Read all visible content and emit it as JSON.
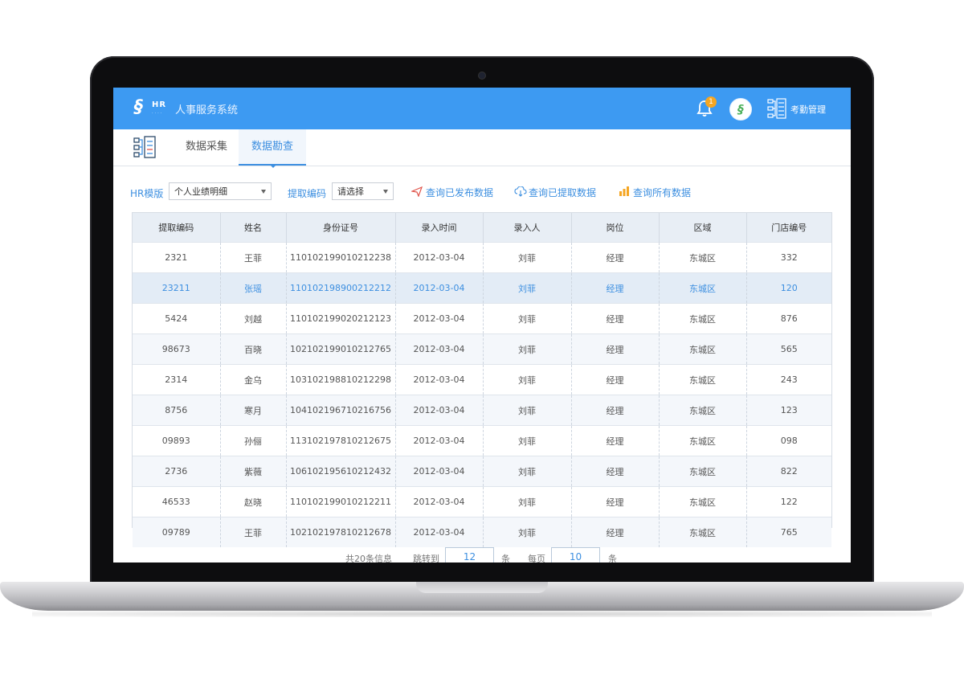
{
  "app": {
    "logo_text": "HR",
    "title": "人事服务系统",
    "notification_count": "1",
    "module_label": "考勤管理"
  },
  "tabs": [
    {
      "label": "数据采集",
      "active": false
    },
    {
      "label": "数据勘查",
      "active": true
    }
  ],
  "filters": {
    "template_label": "HR模版",
    "template_value": "个人业绩明细",
    "code_label": "提取编码",
    "code_value": "请选择",
    "actions": [
      {
        "label": "查询已发布数据",
        "icon": "send-icon"
      },
      {
        "label": "查询已提取数据",
        "icon": "cloud-download-icon"
      },
      {
        "label": "查询所有数据",
        "icon": "bar-chart-icon"
      }
    ]
  },
  "table": {
    "columns": [
      "提取编码",
      "姓名",
      "身份证号",
      "录入时间",
      "录入人",
      "岗位",
      "区域",
      "门店编号"
    ],
    "rows": [
      [
        "2321",
        "王菲",
        "110102199010212238",
        "2012-03-04",
        "刘菲",
        "经理",
        "东城区",
        "332"
      ],
      [
        "23211",
        "张瑶",
        "110102198900212212",
        "2012-03-04",
        "刘菲",
        "经理",
        "东城区",
        "120"
      ],
      [
        "5424",
        "刘越",
        "110102199020212123",
        "2012-03-04",
        "刘菲",
        "经理",
        "东城区",
        "876"
      ],
      [
        "98673",
        "百晓",
        "102102199010212765",
        "2012-03-04",
        "刘菲",
        "经理",
        "东城区",
        "565"
      ],
      [
        "2314",
        "金乌",
        "103102198810212298",
        "2012-03-04",
        "刘菲",
        "经理",
        "东城区",
        "243"
      ],
      [
        "8756",
        "寒月",
        "104102196710216756",
        "2012-03-04",
        "刘菲",
        "经理",
        "东城区",
        "123"
      ],
      [
        "09893",
        "孙俪",
        "113102197810212675",
        "2012-03-04",
        "刘菲",
        "经理",
        "东城区",
        "098"
      ],
      [
        "2736",
        "紫薇",
        "106102195610212432",
        "2012-03-04",
        "刘菲",
        "经理",
        "东城区",
        "822"
      ],
      [
        "46533",
        "赵晓",
        "110102199010212211",
        "2012-03-04",
        "刘菲",
        "经理",
        "东城区",
        "122"
      ],
      [
        "09789",
        "王菲",
        "102102197810212678",
        "2012-03-04",
        "刘菲",
        "经理",
        "东城区",
        "765"
      ]
    ],
    "selected_row": 1
  },
  "pager": {
    "total_text": "共20条信息",
    "jump_label": "跳转到",
    "jump_value": "12",
    "unit1": "条",
    "per_page_label": "每页",
    "per_page_value": "10",
    "unit2": "条"
  },
  "colors": {
    "topbar": "#3d9af2",
    "accent": "#3d8fe0",
    "badge": "#f5a623"
  }
}
